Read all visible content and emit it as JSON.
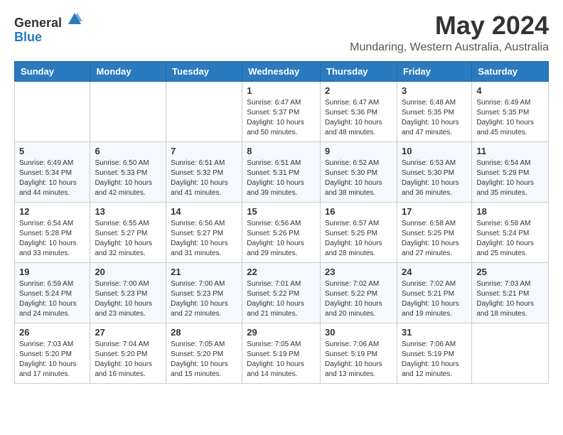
{
  "logo": {
    "general": "General",
    "blue": "Blue"
  },
  "title": "May 2024",
  "location": "Mundaring, Western Australia, Australia",
  "days_of_week": [
    "Sunday",
    "Monday",
    "Tuesday",
    "Wednesday",
    "Thursday",
    "Friday",
    "Saturday"
  ],
  "weeks": [
    [
      {
        "day": "",
        "sunrise": "",
        "sunset": "",
        "daylight": ""
      },
      {
        "day": "",
        "sunrise": "",
        "sunset": "",
        "daylight": ""
      },
      {
        "day": "",
        "sunrise": "",
        "sunset": "",
        "daylight": ""
      },
      {
        "day": "1",
        "sunrise": "Sunrise: 6:47 AM",
        "sunset": "Sunset: 5:37 PM",
        "daylight": "Daylight: 10 hours and 50 minutes."
      },
      {
        "day": "2",
        "sunrise": "Sunrise: 6:47 AM",
        "sunset": "Sunset: 5:36 PM",
        "daylight": "Daylight: 10 hours and 48 minutes."
      },
      {
        "day": "3",
        "sunrise": "Sunrise: 6:48 AM",
        "sunset": "Sunset: 5:35 PM",
        "daylight": "Daylight: 10 hours and 47 minutes."
      },
      {
        "day": "4",
        "sunrise": "Sunrise: 6:49 AM",
        "sunset": "Sunset: 5:35 PM",
        "daylight": "Daylight: 10 hours and 45 minutes."
      }
    ],
    [
      {
        "day": "5",
        "sunrise": "Sunrise: 6:49 AM",
        "sunset": "Sunset: 5:34 PM",
        "daylight": "Daylight: 10 hours and 44 minutes."
      },
      {
        "day": "6",
        "sunrise": "Sunrise: 6:50 AM",
        "sunset": "Sunset: 5:33 PM",
        "daylight": "Daylight: 10 hours and 42 minutes."
      },
      {
        "day": "7",
        "sunrise": "Sunrise: 6:51 AM",
        "sunset": "Sunset: 5:32 PM",
        "daylight": "Daylight: 10 hours and 41 minutes."
      },
      {
        "day": "8",
        "sunrise": "Sunrise: 6:51 AM",
        "sunset": "Sunset: 5:31 PM",
        "daylight": "Daylight: 10 hours and 39 minutes."
      },
      {
        "day": "9",
        "sunrise": "Sunrise: 6:52 AM",
        "sunset": "Sunset: 5:30 PM",
        "daylight": "Daylight: 10 hours and 38 minutes."
      },
      {
        "day": "10",
        "sunrise": "Sunrise: 6:53 AM",
        "sunset": "Sunset: 5:30 PM",
        "daylight": "Daylight: 10 hours and 36 minutes."
      },
      {
        "day": "11",
        "sunrise": "Sunrise: 6:54 AM",
        "sunset": "Sunset: 5:29 PM",
        "daylight": "Daylight: 10 hours and 35 minutes."
      }
    ],
    [
      {
        "day": "12",
        "sunrise": "Sunrise: 6:54 AM",
        "sunset": "Sunset: 5:28 PM",
        "daylight": "Daylight: 10 hours and 33 minutes."
      },
      {
        "day": "13",
        "sunrise": "Sunrise: 6:55 AM",
        "sunset": "Sunset: 5:27 PM",
        "daylight": "Daylight: 10 hours and 32 minutes."
      },
      {
        "day": "14",
        "sunrise": "Sunrise: 6:56 AM",
        "sunset": "Sunset: 5:27 PM",
        "daylight": "Daylight: 10 hours and 31 minutes."
      },
      {
        "day": "15",
        "sunrise": "Sunrise: 6:56 AM",
        "sunset": "Sunset: 5:26 PM",
        "daylight": "Daylight: 10 hours and 29 minutes."
      },
      {
        "day": "16",
        "sunrise": "Sunrise: 6:57 AM",
        "sunset": "Sunset: 5:25 PM",
        "daylight": "Daylight: 10 hours and 28 minutes."
      },
      {
        "day": "17",
        "sunrise": "Sunrise: 6:58 AM",
        "sunset": "Sunset: 5:25 PM",
        "daylight": "Daylight: 10 hours and 27 minutes."
      },
      {
        "day": "18",
        "sunrise": "Sunrise: 6:58 AM",
        "sunset": "Sunset: 5:24 PM",
        "daylight": "Daylight: 10 hours and 25 minutes."
      }
    ],
    [
      {
        "day": "19",
        "sunrise": "Sunrise: 6:59 AM",
        "sunset": "Sunset: 5:24 PM",
        "daylight": "Daylight: 10 hours and 24 minutes."
      },
      {
        "day": "20",
        "sunrise": "Sunrise: 7:00 AM",
        "sunset": "Sunset: 5:23 PM",
        "daylight": "Daylight: 10 hours and 23 minutes."
      },
      {
        "day": "21",
        "sunrise": "Sunrise: 7:00 AM",
        "sunset": "Sunset: 5:23 PM",
        "daylight": "Daylight: 10 hours and 22 minutes."
      },
      {
        "day": "22",
        "sunrise": "Sunrise: 7:01 AM",
        "sunset": "Sunset: 5:22 PM",
        "daylight": "Daylight: 10 hours and 21 minutes."
      },
      {
        "day": "23",
        "sunrise": "Sunrise: 7:02 AM",
        "sunset": "Sunset: 5:22 PM",
        "daylight": "Daylight: 10 hours and 20 minutes."
      },
      {
        "day": "24",
        "sunrise": "Sunrise: 7:02 AM",
        "sunset": "Sunset: 5:21 PM",
        "daylight": "Daylight: 10 hours and 19 minutes."
      },
      {
        "day": "25",
        "sunrise": "Sunrise: 7:03 AM",
        "sunset": "Sunset: 5:21 PM",
        "daylight": "Daylight: 10 hours and 18 minutes."
      }
    ],
    [
      {
        "day": "26",
        "sunrise": "Sunrise: 7:03 AM",
        "sunset": "Sunset: 5:20 PM",
        "daylight": "Daylight: 10 hours and 17 minutes."
      },
      {
        "day": "27",
        "sunrise": "Sunrise: 7:04 AM",
        "sunset": "Sunset: 5:20 PM",
        "daylight": "Daylight: 10 hours and 16 minutes."
      },
      {
        "day": "28",
        "sunrise": "Sunrise: 7:05 AM",
        "sunset": "Sunset: 5:20 PM",
        "daylight": "Daylight: 10 hours and 15 minutes."
      },
      {
        "day": "29",
        "sunrise": "Sunrise: 7:05 AM",
        "sunset": "Sunset: 5:19 PM",
        "daylight": "Daylight: 10 hours and 14 minutes."
      },
      {
        "day": "30",
        "sunrise": "Sunrise: 7:06 AM",
        "sunset": "Sunset: 5:19 PM",
        "daylight": "Daylight: 10 hours and 13 minutes."
      },
      {
        "day": "31",
        "sunrise": "Sunrise: 7:06 AM",
        "sunset": "Sunset: 5:19 PM",
        "daylight": "Daylight: 10 hours and 12 minutes."
      },
      {
        "day": "",
        "sunrise": "",
        "sunset": "",
        "daylight": ""
      }
    ]
  ]
}
